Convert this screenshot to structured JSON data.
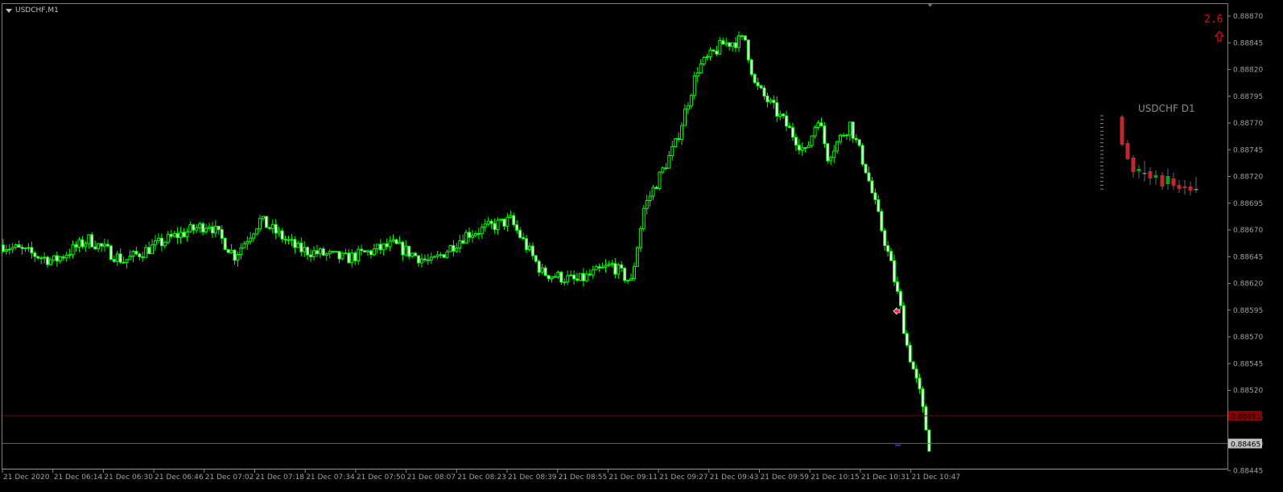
{
  "window": {
    "title": "USDCHF,M1",
    "menu_icon": "triangle-down-icon"
  },
  "widget": {
    "spread": "2.6",
    "spread_icon": "arrow-up-outline-icon",
    "d1_label": "USDCHF D1"
  },
  "colors": {
    "background": "#000000",
    "candle": "#00ff00",
    "bid_line": "#8b0000",
    "ask_line": "#4f6f6f",
    "axis_text": "#a0a0a0",
    "spread": "#ff0000",
    "d1_bear": "#c0282f",
    "d1_bull": "#10a010"
  },
  "chart_data": {
    "type": "candlestick",
    "symbol": "USDCHF",
    "timeframe": "M1",
    "ylim": [
      0.88435,
      0.8888
    ],
    "y_ticks": [
      "0.88870",
      "0.88845",
      "0.88820",
      "0.88795",
      "0.88770",
      "0.88745",
      "0.88720",
      "0.88695",
      "0.88670",
      "0.88645",
      "0.88620",
      "0.88595",
      "0.88570",
      "0.88545",
      "0.88520",
      "0.88495",
      "0.88470",
      "0.88445"
    ],
    "x_ticks": [
      "21 Dec 2020",
      "21 Dec 06:14",
      "21 Dec 06:30",
      "21 Dec 06:46",
      "21 Dec 07:02",
      "21 Dec 07:18",
      "21 Dec 07:34",
      "21 Dec 07:50",
      "21 Dec 08:07",
      "21 Dec 08:23",
      "21 Dec 08:39",
      "21 Dec 08:55",
      "21 Dec 09:11",
      "21 Dec 09:27",
      "21 Dec 09:43",
      "21 Dec 09:59",
      "21 Dec 10:15",
      "21 Dec 10:31",
      "21 Dec 10:47"
    ],
    "price_path": [
      [
        "05:59",
        0.88656
      ],
      [
        "06:15",
        0.88641
      ],
      [
        "06:26",
        0.88661
      ],
      [
        "06:37",
        0.88641
      ],
      [
        "06:53",
        0.88664
      ],
      [
        "07:04",
        0.88676
      ],
      [
        "07:12",
        0.88646
      ],
      [
        "07:20",
        0.88679
      ],
      [
        "07:32",
        0.88652
      ],
      [
        "07:47",
        0.88643
      ],
      [
        "08:02",
        0.88656
      ],
      [
        "08:14",
        0.88639
      ],
      [
        "08:25",
        0.88666
      ],
      [
        "08:39",
        0.88679
      ],
      [
        "08:49",
        0.8863
      ],
      [
        "09:00",
        0.88622
      ],
      [
        "09:11",
        0.88637
      ],
      [
        "09:17",
        0.88621
      ],
      [
        "09:21",
        0.8869
      ],
      [
        "09:31",
        0.8875
      ],
      [
        "09:38",
        0.88821
      ],
      [
        "09:46",
        0.88844
      ],
      [
        "09:53",
        0.88848
      ],
      [
        "09:56",
        0.88806
      ],
      [
        "10:05",
        0.88772
      ],
      [
        "10:12",
        0.88742
      ],
      [
        "10:16",
        0.88776
      ],
      [
        "10:19",
        0.88739
      ],
      [
        "10:26",
        0.88769
      ],
      [
        "10:31",
        0.88727
      ],
      [
        "10:35",
        0.88682
      ],
      [
        "10:39",
        0.88637
      ],
      [
        "10:42",
        0.88596
      ],
      [
        "10:44",
        0.88562
      ],
      [
        "10:48",
        0.88517
      ],
      [
        "10:51",
        0.88468
      ]
    ],
    "bid": {
      "value": 0.88491,
      "label": "0.88491"
    },
    "ask": {
      "value": 0.88465,
      "label": "0.88465"
    }
  }
}
